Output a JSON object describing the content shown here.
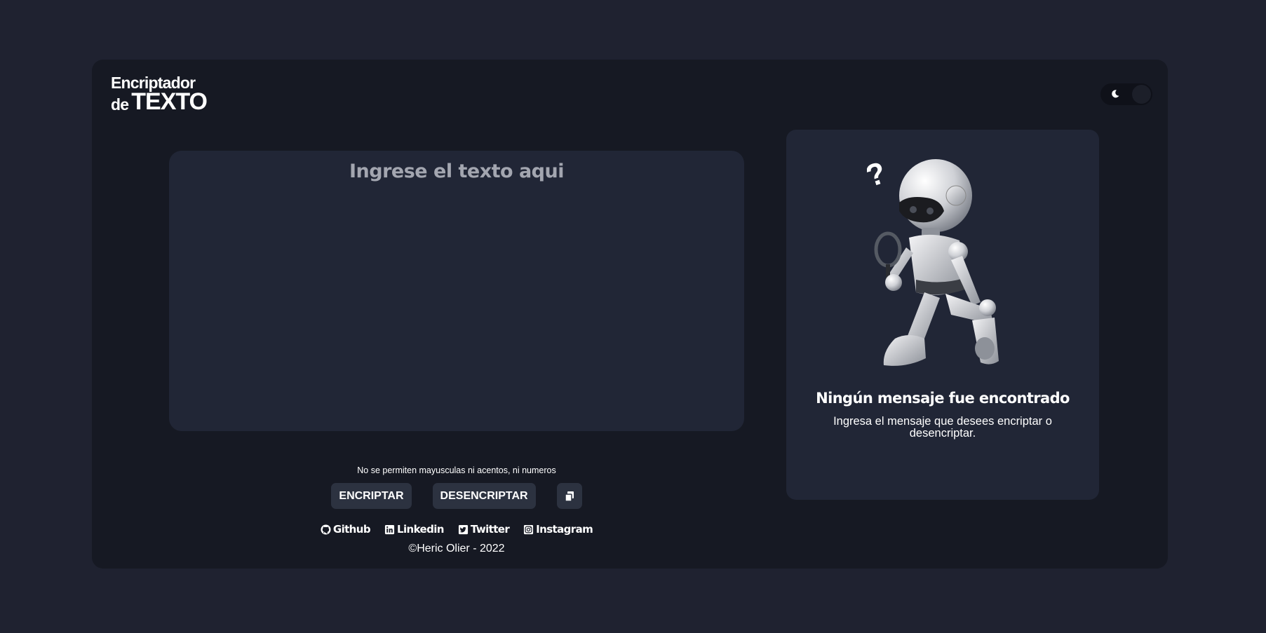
{
  "header": {
    "logo_line1": "Encriptador",
    "logo_line2_small": "de",
    "logo_line2_big": "TEXTO"
  },
  "theme_toggle": {
    "icon": "moon-icon",
    "state": "dark"
  },
  "input": {
    "placeholder": "Ingrese el texto aqui",
    "value": ""
  },
  "warning": "No se permiten mayusculas ni acentos, ni numeros",
  "buttons": {
    "encrypt": "ENCRIPTAR",
    "decrypt": "DESENCRIPTAR",
    "copy_icon": "copy-icon"
  },
  "links": [
    {
      "label": "Github",
      "icon": "github-icon"
    },
    {
      "label": "Linkedin",
      "icon": "linkedin-icon"
    },
    {
      "label": "Twitter",
      "icon": "twitter-icon"
    },
    {
      "label": "Instagram",
      "icon": "instagram-icon"
    }
  ],
  "copyright": "©Heric Olier - 2022",
  "output": {
    "title": "Ningún mensaje fue encontrado",
    "subtitle": "Ingresa el mensaje que desees encriptar o desencriptar."
  },
  "colors": {
    "page_bg": "#1f2230",
    "card_bg": "#161923",
    "panel_bg": "#212636",
    "button_bg": "#2c3240",
    "placeholder": "#a3a6b0"
  }
}
